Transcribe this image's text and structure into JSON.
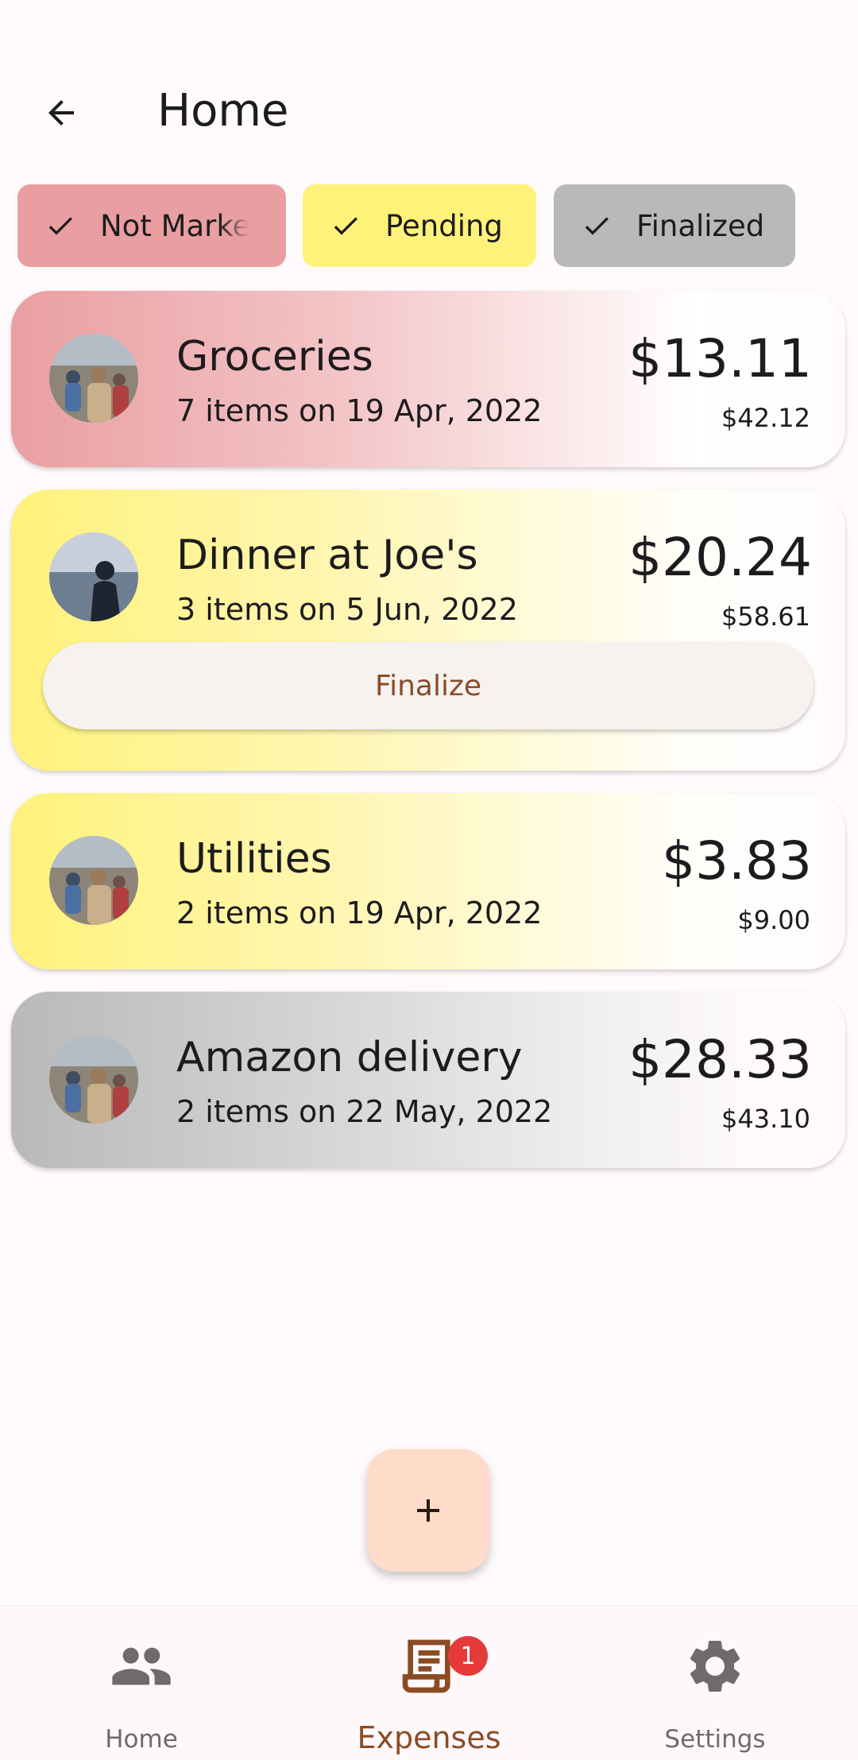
{
  "header": {
    "title": "Home",
    "back_icon": "arrow-left-icon"
  },
  "filters": [
    {
      "label": "Not Marked",
      "color": "#e99fa1",
      "selected": true
    },
    {
      "label": "Pending",
      "color": "#fff27a",
      "selected": true
    },
    {
      "label": "Finalized",
      "color": "#b9b9b9",
      "selected": true
    }
  ],
  "expenses": [
    {
      "title": "Groceries",
      "subtitle": "7 items on 19 Apr, 2022",
      "amount": "$13.11",
      "total": "$42.12",
      "status": "not-marked",
      "color": "#e99fa1"
    },
    {
      "title": "Dinner at Joe's",
      "subtitle": "3 items on 5 Jun, 2022",
      "amount": "$20.24",
      "total": "$58.61",
      "status": "pending",
      "color": "#fff27a",
      "action_label": "Finalize"
    },
    {
      "title": "Utilities",
      "subtitle": "2 items on 19 Apr, 2022",
      "amount": "$3.83",
      "total": "$9.00",
      "status": "pending",
      "color": "#fff27a"
    },
    {
      "title": "Amazon delivery",
      "subtitle": "2 items on 22 May, 2022",
      "amount": "$28.33",
      "total": "$43.10",
      "status": "finalized",
      "color": "#b9b9b9"
    }
  ],
  "fab": {
    "icon": "plus-icon"
  },
  "bottom_nav": {
    "items": [
      {
        "label": "Home",
        "icon": "people-icon",
        "active": false
      },
      {
        "label": "Expenses",
        "icon": "receipt-icon",
        "active": true,
        "badge": "1"
      },
      {
        "label": "Settings",
        "icon": "gear-icon",
        "active": false
      }
    ]
  },
  "colors": {
    "accent": "#8b4c24",
    "fab": "#ffdbc9",
    "badge": "#e5393a",
    "background": "#fffbfd"
  }
}
